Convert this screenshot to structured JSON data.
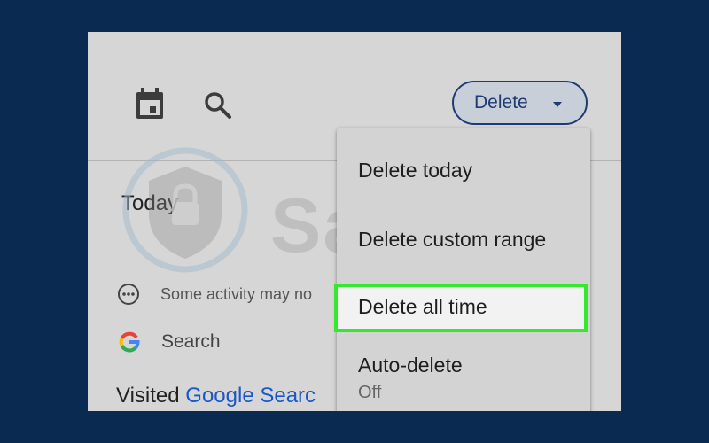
{
  "toolbar": {
    "calendar_icon": "calendar-icon",
    "search_icon": "search-icon",
    "delete_label": "Delete"
  },
  "section": {
    "title": "Today"
  },
  "activity_notice": {
    "text": "Some activity may no",
    "icon": "more-horizontal-icon"
  },
  "search_row": {
    "label": "Search",
    "icon": "google-g-icon"
  },
  "visited": {
    "prefix": "Visited",
    "link": "Google Searc"
  },
  "menu": {
    "items": [
      {
        "label": "Delete today"
      },
      {
        "label": "Delete custom range"
      },
      {
        "label": "Delete all time",
        "highlighted": true
      },
      {
        "label": "Auto-delete",
        "sub": "Off"
      }
    ]
  },
  "watermark": {
    "text": "Safelyo"
  },
  "colors": {
    "background": "#0b2a52",
    "panel": "#d6d6d6",
    "accent": "#1f3b73",
    "link": "#1a57c7",
    "highlight_border": "#35e82b"
  }
}
